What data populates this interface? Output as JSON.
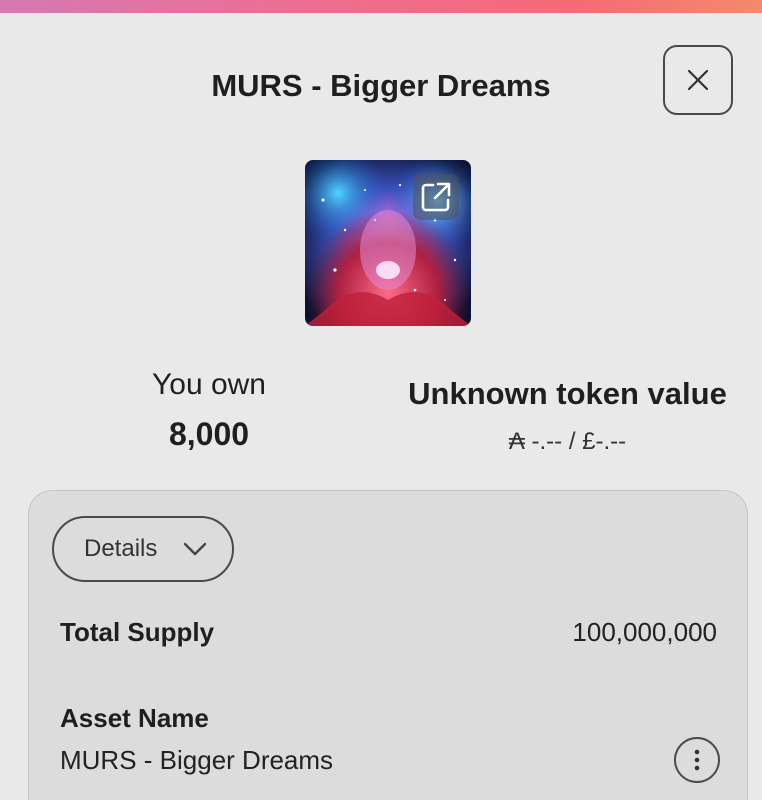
{
  "header": {
    "title": "MURS - Bigger Dreams",
    "close_icon": "close-icon"
  },
  "artwork": {
    "alt": "token artwork",
    "open_icon": "external-link-icon"
  },
  "stats": {
    "owned_label": "You own",
    "owned_value": "8,000",
    "value_label": "Unknown token value",
    "value_amount": "₳ -.-- / £-.--"
  },
  "details": {
    "toggle_label": "Details",
    "toggle_icon": "chevron-down-icon",
    "total_supply_label": "Total Supply",
    "total_supply_value": "100,000,000",
    "asset_name_label": "Asset Name",
    "asset_name_value": "MURS - Bigger Dreams",
    "more_icon": "more-vertical-icon"
  },
  "colors": {
    "accent_gradient_start": "#d678b4",
    "accent_gradient_end": "#f48a6a",
    "background": "#e9e9ea",
    "card_background": "#dcdcdd"
  }
}
